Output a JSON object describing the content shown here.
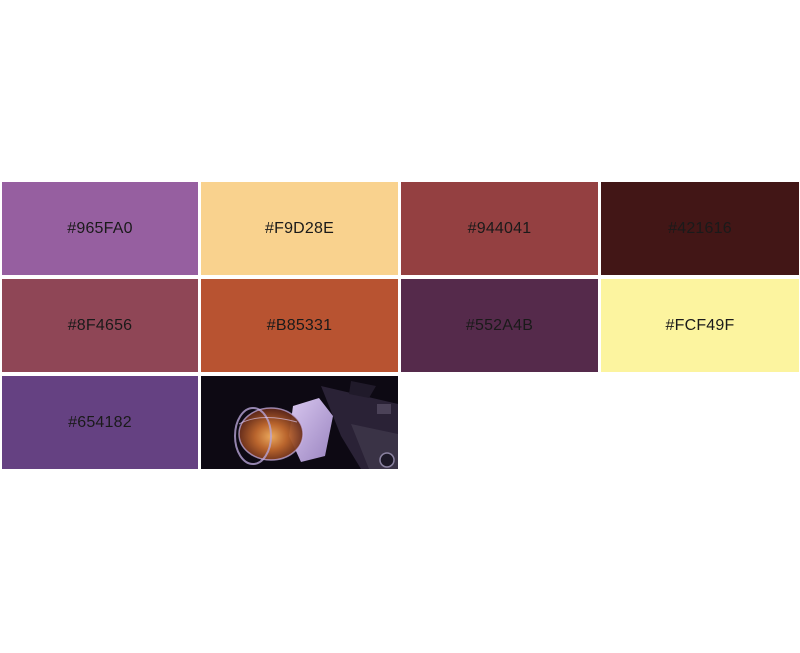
{
  "palette": {
    "swatches": [
      {
        "label": "#965FA0",
        "color": "#965FA0"
      },
      {
        "label": "#F9D28E",
        "color": "#F9D28E"
      },
      {
        "label": "#944041",
        "color": "#944041"
      },
      {
        "label": "#421616",
        "color": "#421616"
      },
      {
        "label": "#8F4656",
        "color": "#8F4656"
      },
      {
        "label": "#B85331",
        "color": "#B85331"
      },
      {
        "label": "#552A4B",
        "color": "#552A4B"
      },
      {
        "label": "#FCF49F",
        "color": "#FCF49F"
      },
      {
        "label": "#654182",
        "color": "#654182"
      }
    ],
    "source_image": {
      "description": "glass-of-liquor-photo"
    }
  }
}
